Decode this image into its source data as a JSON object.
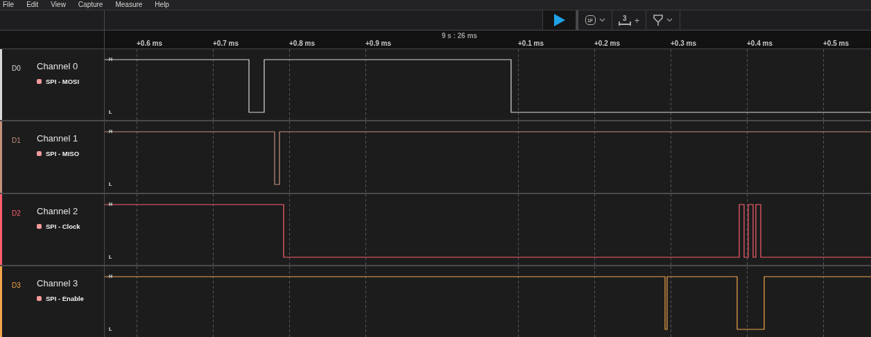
{
  "menu": [
    "File",
    "Edit",
    "View",
    "Capture",
    "Measure",
    "Help"
  ],
  "toolbar": {
    "trigger_label": "1F",
    "measure_count": "3",
    "measure_plus": "+"
  },
  "ruler": {
    "origin": "9 s : 26 ms",
    "ticks": [
      "+0.6 ms",
      "+0.7 ms",
      "+0.8 ms",
      "+0.9 ms",
      "+0.1 ms",
      "+0.2 ms",
      "+0.3 ms",
      "+0.4 ms",
      "+0.5 ms"
    ]
  },
  "channels": [
    {
      "id": "D0",
      "name": "Channel 0",
      "analyzer": "SPI - MOSI",
      "color": "#d9d9d9",
      "high": "H",
      "low": "L"
    },
    {
      "id": "D1",
      "name": "Channel 1",
      "analyzer": "SPI - MISO",
      "color": "#c4927a",
      "high": "H",
      "low": "L"
    },
    {
      "id": "D2",
      "name": "Channel 2",
      "analyzer": "SPI - Clock",
      "color": "#ff5f6d",
      "high": "H",
      "low": "L"
    },
    {
      "id": "D3",
      "name": "Channel 3",
      "analyzer": "SPI - Enable",
      "color": "#f5a54a",
      "high": "H",
      "low": "L"
    }
  ]
}
